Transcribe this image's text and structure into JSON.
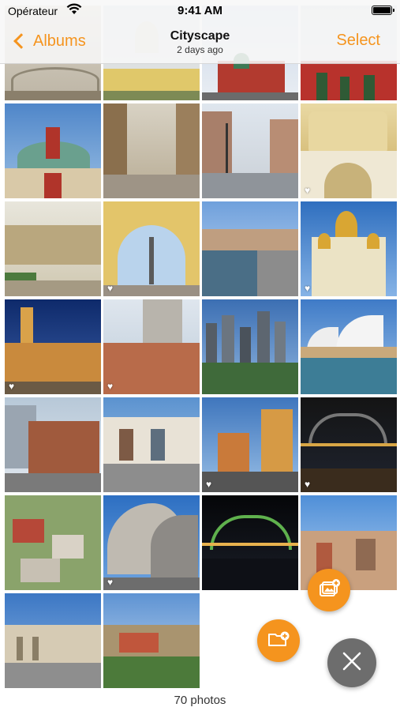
{
  "status_bar": {
    "carrier": "Opérateur",
    "time": "9:41 AM",
    "wifi_icon": "wifi-icon",
    "battery_icon": "battery-icon"
  },
  "nav": {
    "back_label": "Albums",
    "title": "Cityscape",
    "subtitle": "2 days ago",
    "select_label": "Select"
  },
  "grid": {
    "columns": 4,
    "photos": [
      {
        "id": "p0",
        "subject": "vaulted hall ceiling",
        "favorite": false
      },
      {
        "id": "p1",
        "subject": "yellow palace facade",
        "favorite": false
      },
      {
        "id": "p2",
        "subject": "red cathedral domes",
        "favorite": false
      },
      {
        "id": "p3",
        "subject": "red wall with trees",
        "favorite": false
      },
      {
        "id": "p4",
        "subject": "kremlin palace dome",
        "favorite": false
      },
      {
        "id": "p5",
        "subject": "shopping arcade",
        "favorite": false
      },
      {
        "id": "p6",
        "subject": "street with lamps",
        "favorite": false
      },
      {
        "id": "p7",
        "subject": "ornate palace interior",
        "favorite": true
      },
      {
        "id": "p8",
        "subject": "glass-roofed arcade",
        "favorite": false
      },
      {
        "id": "p9",
        "subject": "arch with column",
        "favorite": true
      },
      {
        "id": "p10",
        "subject": "canal with boats",
        "favorite": false
      },
      {
        "id": "p11",
        "subject": "golden domed church",
        "favorite": true
      },
      {
        "id": "p12",
        "subject": "town hall at dusk",
        "favorite": true
      },
      {
        "id": "p13",
        "subject": "heritage building and tower",
        "favorite": true
      },
      {
        "id": "p14",
        "subject": "city skyline",
        "favorite": false
      },
      {
        "id": "p15",
        "subject": "opera house",
        "favorite": false
      },
      {
        "id": "p16",
        "subject": "brick building street",
        "favorite": false
      },
      {
        "id": "p17",
        "subject": "terrace houses",
        "favorite": false
      },
      {
        "id": "p18",
        "subject": "modern towers",
        "favorite": true
      },
      {
        "id": "p19",
        "subject": "harbour bridge at night",
        "favorite": true
      },
      {
        "id": "p20",
        "subject": "rooftops aerial",
        "favorite": false
      },
      {
        "id": "p21",
        "subject": "opera house shells",
        "favorite": true
      },
      {
        "id": "p22",
        "subject": "lit bridge night",
        "favorite": false
      },
      {
        "id": "p23",
        "subject": "old town panorama",
        "favorite": false
      },
      {
        "id": "p24",
        "subject": "colonnaded building",
        "favorite": false
      },
      {
        "id": "p25",
        "subject": "hillside town",
        "favorite": false
      }
    ]
  },
  "footer": {
    "count_text": "70 photos"
  },
  "actions": {
    "add_photo_icon": "add-photo-icon",
    "new_folder_icon": "new-folder-icon",
    "close_icon": "close-icon",
    "accent_color": "#F5941E",
    "close_color": "#6d6d6d"
  }
}
